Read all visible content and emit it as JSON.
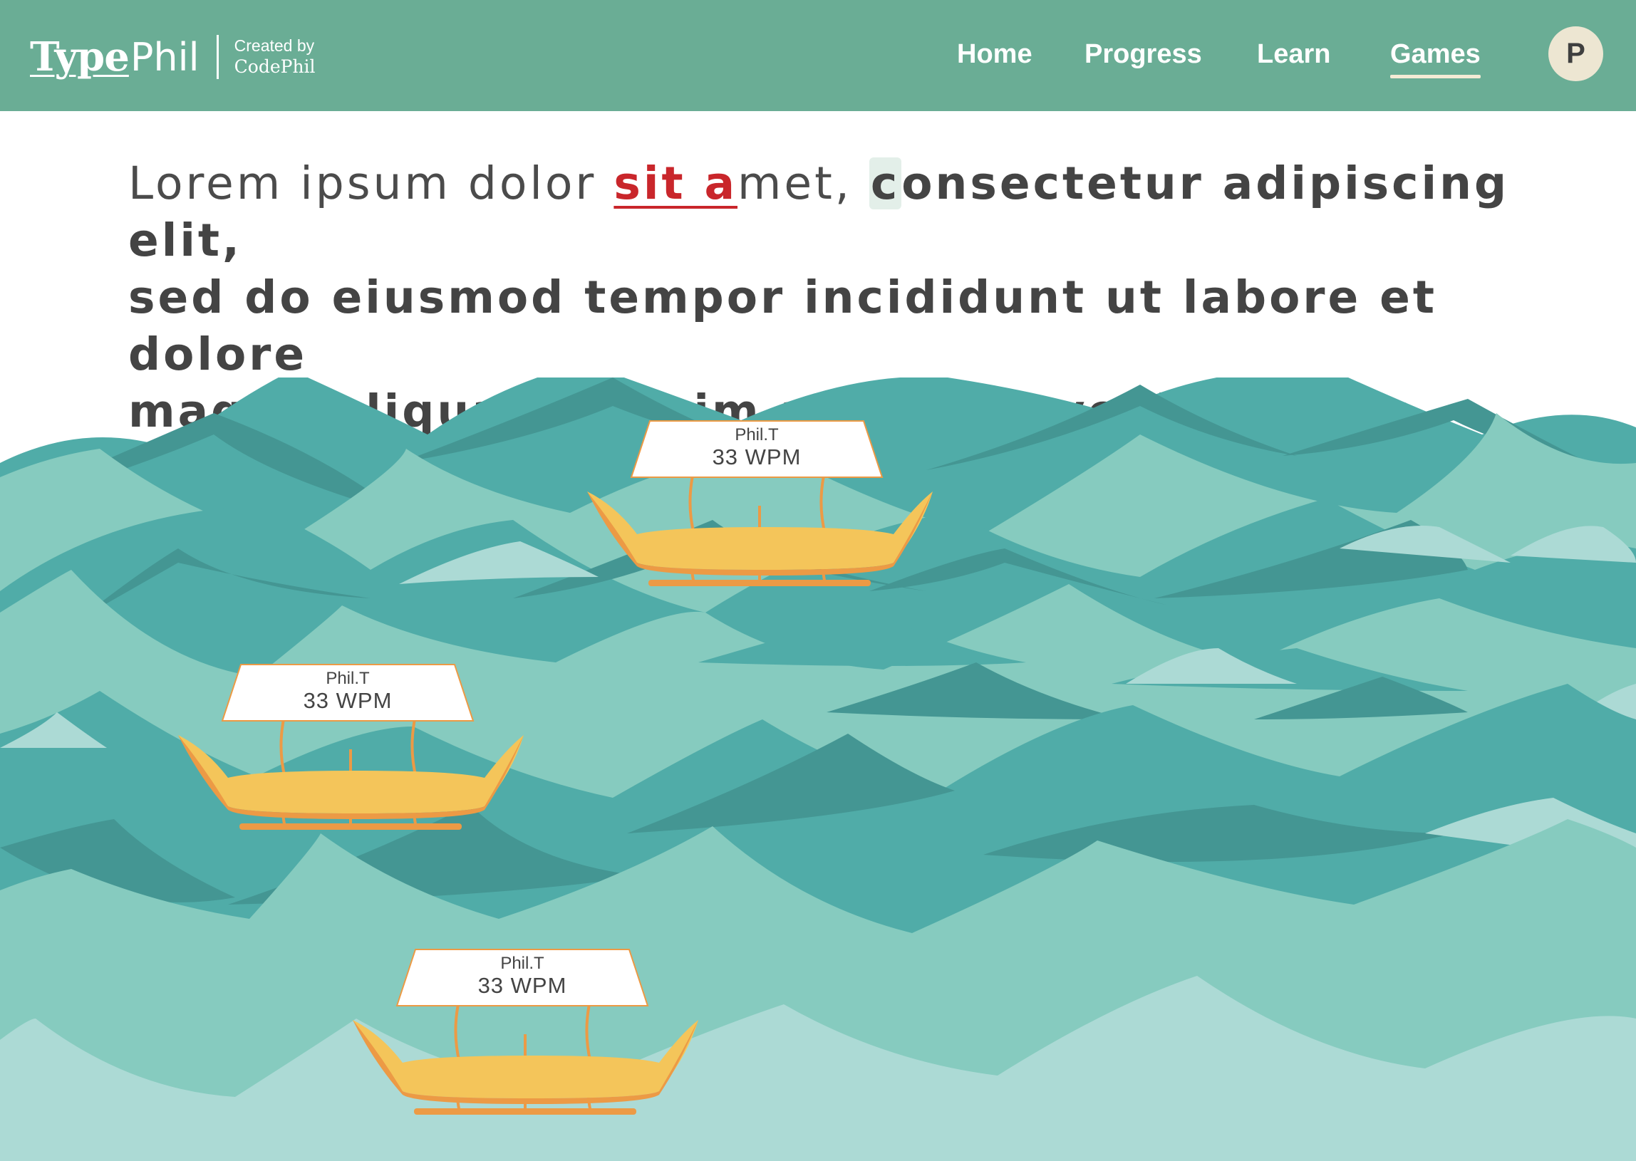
{
  "brand": {
    "name_bold": "Type",
    "name_light": "Phil",
    "credit_line": "Created by",
    "credit_name": "CodePhil"
  },
  "nav": {
    "items": [
      {
        "label": "Home"
      },
      {
        "label": "Progress"
      },
      {
        "label": "Learn"
      },
      {
        "label": "Games",
        "active": true
      }
    ]
  },
  "user": {
    "initial": "P"
  },
  "passage": {
    "typed": "Lorem ipsum dolor ",
    "error": "sit a",
    "typed_after_error": "met, ",
    "current_char": "c",
    "remaining_line1": "onsectetur adipiscing elit,",
    "remaining_line2": "sed do eiusmod tempor incididunt ut labore et dolore",
    "remaining_line3": "magna aliqua. Ut enim ad minim veniam, quis."
  },
  "racers": [
    {
      "name": "Phil.T",
      "wpm": "33 WPM"
    },
    {
      "name": "Phil.T",
      "wpm": "33 WPM"
    },
    {
      "name": "Phil.T",
      "wpm": "33 WPM"
    }
  ],
  "colors": {
    "header": "#6aad95",
    "error": "#c9262b",
    "text": "#444444",
    "wave_light": "#acdad5",
    "wave_mid": "#86cbbf",
    "wave_teal": "#50aca8",
    "wave_dark": "#449693",
    "boat_hull": "#f4c55a",
    "boat_trim": "#ec9a45"
  }
}
